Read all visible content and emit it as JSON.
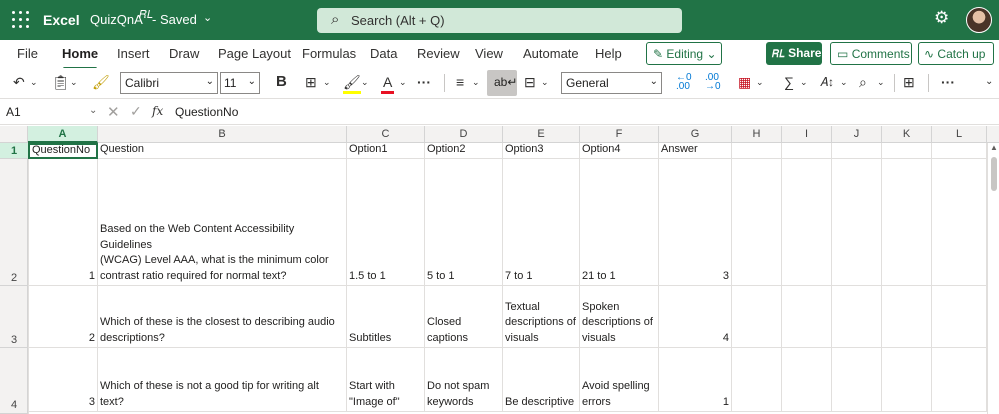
{
  "titlebar": {
    "app_name": "Excel",
    "doc_name": "QuizQnA",
    "saved_status": "- Saved",
    "search_placeholder": "Search (Alt + Q)",
    "icons": [
      "waffle-icon",
      "person-icon",
      "chevron-down-icon",
      "search-icon",
      "gear-icon",
      "avatar"
    ]
  },
  "menu": {
    "items": [
      "File",
      "Home",
      "Insert",
      "Draw",
      "Page Layout",
      "Formulas",
      "Data",
      "Review",
      "View",
      "Automate",
      "Help"
    ],
    "active": "Home",
    "editing_label": "Editing",
    "share_label": "Share",
    "comments_label": "Comments",
    "catchup_label": "Catch up"
  },
  "toolbar": {
    "font_name": "Calibri",
    "font_size": "11",
    "bold_label": "B",
    "number_format": "General",
    "more_label": "···",
    "accent_color": "#217346",
    "highlight_color": "#ffff00",
    "font_color": "#e81123"
  },
  "formula_bar": {
    "name_box": "A1",
    "fx_label": "fx",
    "value": "QuestionNo"
  },
  "columns": [
    "A",
    "B",
    "C",
    "D",
    "E",
    "F",
    "G",
    "H",
    "I",
    "J",
    "K",
    "L"
  ],
  "row_numbers": [
    "1",
    "2",
    "3",
    "4"
  ],
  "sheet": {
    "header": [
      "QuestionNo",
      "Question",
      "Option1",
      "Option2",
      "Option3",
      "Option4",
      "Answer"
    ],
    "rows": [
      [
        "1",
        "Based on the Web Content Accessibility Guidelines\n(WCAG) Level AAA, what is the minimum color\ncontrast ratio required for normal text?",
        "1.5 to 1",
        "5 to 1",
        "7 to 1",
        "21 to 1",
        "3"
      ],
      [
        "2",
        "Which of these is the closest to describing audio\ndescriptions?",
        "Subtitles",
        "Closed captions",
        "Textual\ndescriptions of\nvisuals",
        "Spoken\ndescriptions of\nvisuals",
        "4"
      ],
      [
        "3",
        "Which of these is not a good tip for writing alt text?",
        "Start with\n\"Image of\"",
        "Do not spam\nkeywords",
        "Be descriptive",
        "Avoid spelling\nerrors",
        "1"
      ]
    ]
  }
}
